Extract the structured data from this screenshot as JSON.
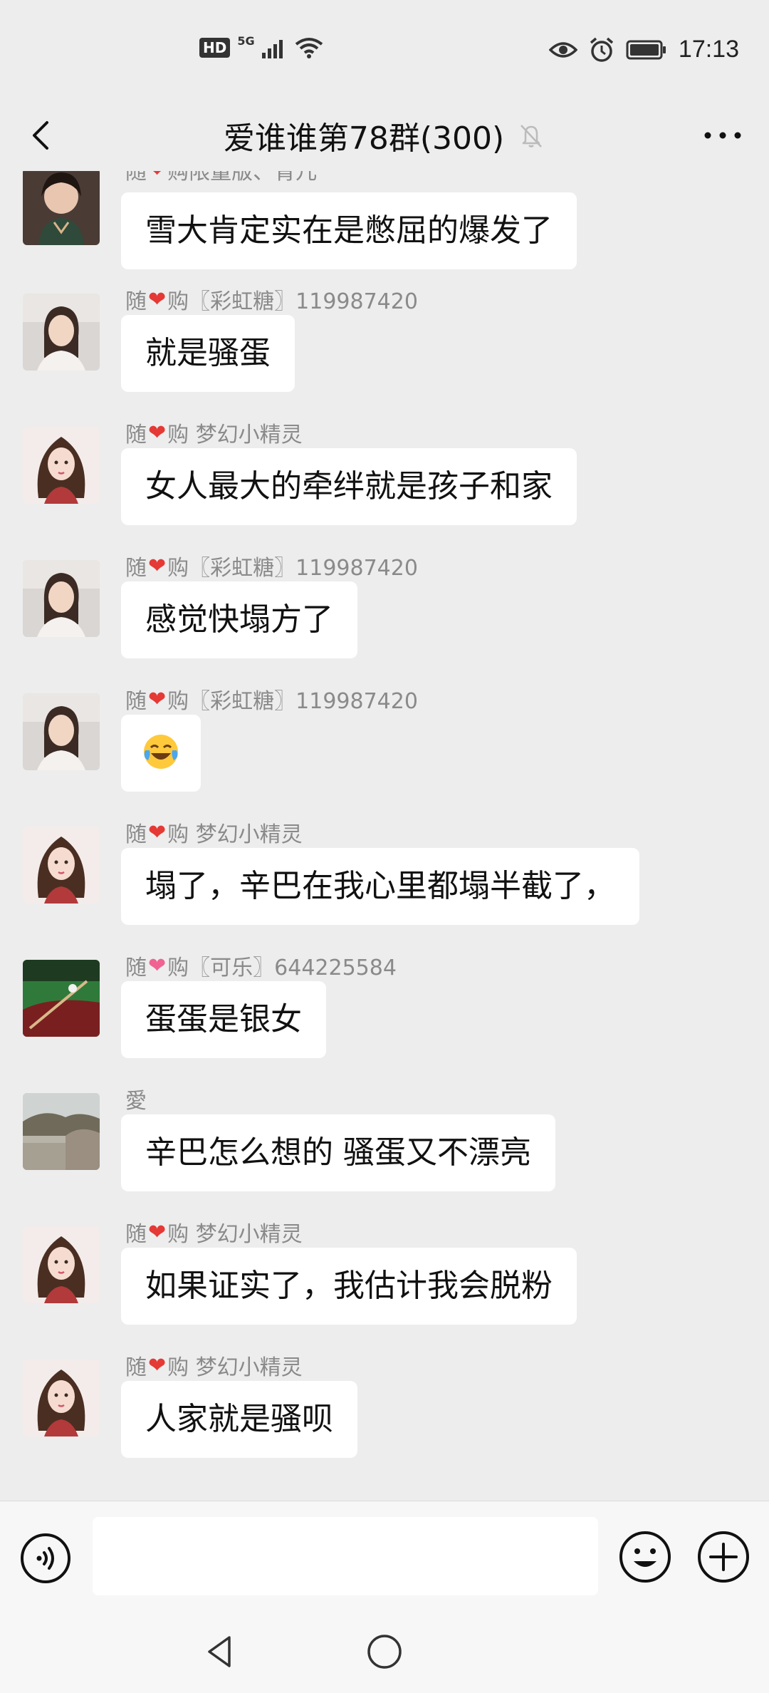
{
  "status_bar": {
    "hd": "HD",
    "network": "5G",
    "time": "17:13",
    "icons": [
      "signal-icon",
      "wifi-icon",
      "eye-icon",
      "alarm-icon",
      "battery-icon"
    ]
  },
  "nav": {
    "title": "爱谁谁第78群(300)",
    "icons": [
      "back-icon",
      "mute-bell-icon",
      "more-icon"
    ]
  },
  "messages": [
    {
      "sender_prefix": "随",
      "sender_mid": "购",
      "sender_suffix": "限量版、青儿",
      "text": "雪大肯定实在是憋屈的爆发了",
      "avatar": "avatar-woman-vintage"
    },
    {
      "sender_prefix": "随",
      "sender_mid": "购",
      "sender_suffix": "〖彩虹糖〗119987420",
      "text": "就是骚蛋",
      "avatar": "avatar-woman-photo"
    },
    {
      "sender_prefix": "随",
      "sender_mid": "购",
      "sender_suffix": "梦幻小精灵",
      "text": "女人最大的牵绊就是孩子和家",
      "avatar": "avatar-cartoon-girl"
    },
    {
      "sender_prefix": "随",
      "sender_mid": "购",
      "sender_suffix": "〖彩虹糖〗119987420",
      "text": "感觉快塌方了",
      "avatar": "avatar-woman-photo"
    },
    {
      "sender_prefix": "随",
      "sender_mid": "购",
      "sender_suffix": "〖彩虹糖〗119987420",
      "text": "",
      "emoji": "laughing-crying-emoji",
      "avatar": "avatar-woman-photo"
    },
    {
      "sender_prefix": "随",
      "sender_mid": "购",
      "sender_suffix": "梦幻小精灵",
      "text": "塌了，辛巴在我心里都塌半截了，",
      "avatar": "avatar-cartoon-girl"
    },
    {
      "sender_prefix": "随",
      "sender_mid": "购",
      "sender_suffix": "〖可乐〗644225584",
      "text": "蛋蛋是银女",
      "avatar": "avatar-billiards"
    },
    {
      "sender_prefix": "愛",
      "sender_mid": "",
      "sender_suffix": "",
      "text": "辛巴怎么想的 骚蛋又不漂亮",
      "avatar": "avatar-landscape"
    },
    {
      "sender_prefix": "随",
      "sender_mid": "购",
      "sender_suffix": "梦幻小精灵",
      "text": "如果证实了，我估计我会脱粉",
      "avatar": "avatar-cartoon-girl"
    },
    {
      "sender_prefix": "随",
      "sender_mid": "购",
      "sender_suffix": "梦幻小精灵",
      "text": "人家就是骚呗",
      "avatar": "avatar-cartoon-girl"
    }
  ],
  "input_bar": {
    "placeholder": "",
    "icons": [
      "voice-icon",
      "emoji-icon",
      "plus-icon"
    ]
  },
  "system_nav": {
    "icons": [
      "nav-back-triangle-icon",
      "nav-home-circle-icon"
    ]
  },
  "colors": {
    "background": "#ededed",
    "bubble": "#ffffff",
    "heart": "#e53935",
    "sender_text": "#8a8a8a"
  }
}
